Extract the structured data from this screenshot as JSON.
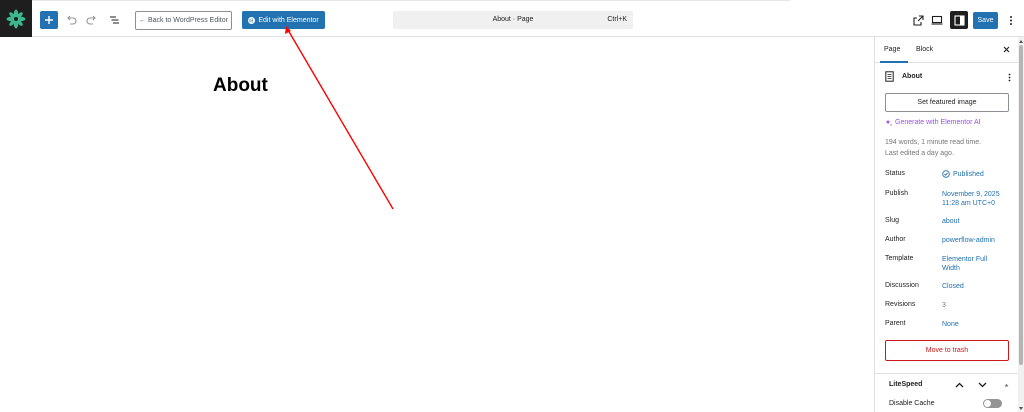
{
  "toolbar": {
    "back_label": "← Back to WordPress Editor",
    "elementor_label": "Edit with Elementor",
    "command_title": "About · Page",
    "command_shortcut": "Ctrl+K",
    "save_label": "Save"
  },
  "canvas": {
    "title": "About"
  },
  "sidebar": {
    "tabs": [
      {
        "label": "Page"
      },
      {
        "label": "Block"
      }
    ],
    "doc_title": "About",
    "featured_label": "Set featured image",
    "ai_label": "Generate with Elementor AI",
    "meta_words": "194 words, 1 minute read time.",
    "meta_edited": "Last edited a day ago.",
    "fields": {
      "status": {
        "label": "Status",
        "value": "Published"
      },
      "publish": {
        "label": "Publish",
        "value1": "November 9, 2025",
        "value2": "11:28 am UTC+0"
      },
      "slug": {
        "label": "Slug",
        "value": "about"
      },
      "author": {
        "label": "Author",
        "value": "powerflow-admin"
      },
      "template": {
        "label": "Template",
        "value1": "Elementor Full",
        "value2": "Width"
      },
      "discussion": {
        "label": "Discussion",
        "value": "Closed"
      },
      "revisions": {
        "label": "Revisions",
        "value": "3"
      },
      "parent": {
        "label": "Parent",
        "value": "None"
      }
    },
    "trash_label": "Move to trash",
    "litespeed": {
      "title": "LiteSpeed",
      "cache_label": "Disable Cache",
      "cache_on": false
    }
  },
  "colors": {
    "accent": "#2271b1",
    "danger": "#cc1818",
    "ai": "#9b51e0",
    "annotation": "#ff0000"
  }
}
